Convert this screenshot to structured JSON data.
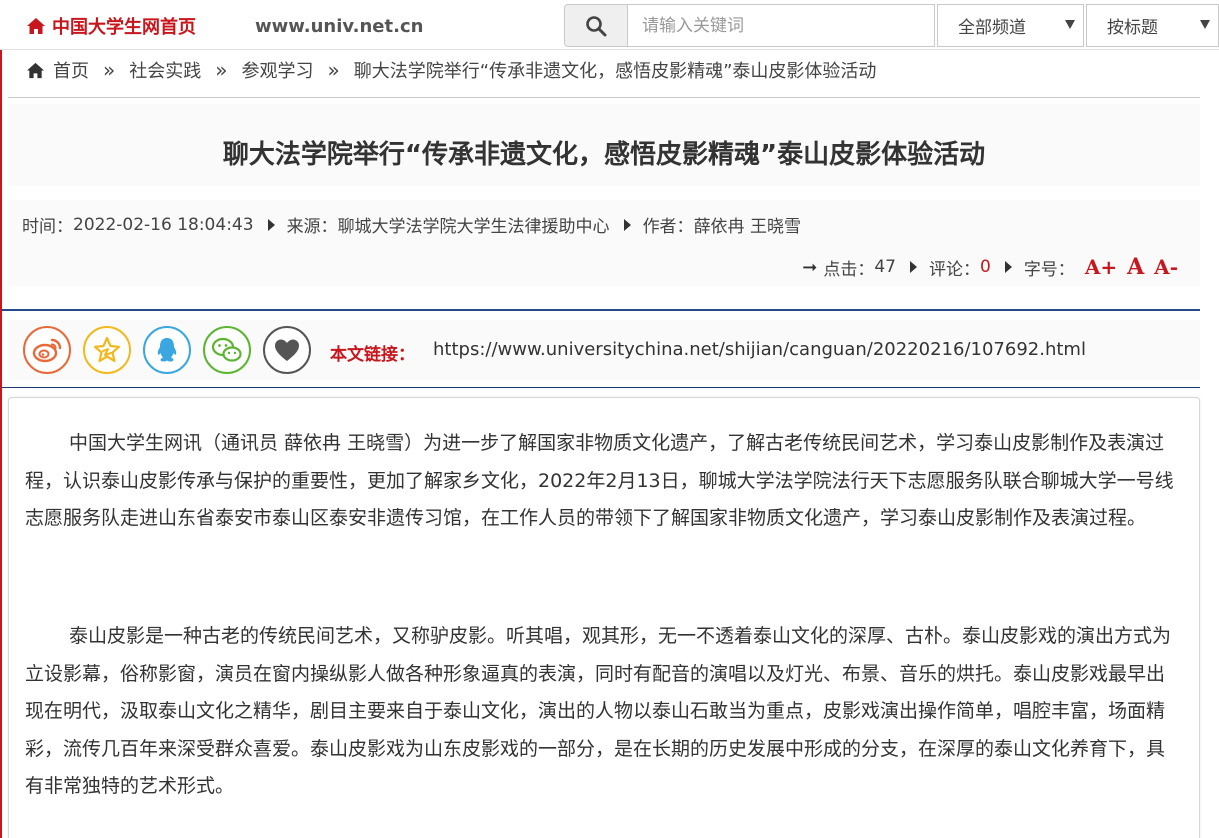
{
  "header": {
    "home_label": "中国大学生网首页",
    "domain": "www.univ.net.cn",
    "search_placeholder": "请输入关键词",
    "channel_select": "全部频道",
    "field_select": "按标题"
  },
  "breadcrumb": {
    "items": [
      "首页",
      "社会实践",
      "参观学习",
      "聊大法学院举行“传承非遗文化，感悟皮影精魂”泰山皮影体验活动"
    ],
    "separator": "»"
  },
  "article": {
    "title": "聊大法学院举行“传承非遗文化，感悟皮影精魂”泰山皮影体验活动",
    "time_label": "时间：",
    "time": "2022-02-16 18:04:43",
    "source_label": "来源：",
    "source": "聊城大学法学院大学生法律援助中心",
    "author_label": "作者：",
    "author": "薛依冉 王晓雪",
    "clicks_label": "点击：",
    "clicks": "47",
    "comments_label": "评论：",
    "comments": "0",
    "fontsize_label": "字号：",
    "font_larger": "A+",
    "font_normal": "A",
    "font_smaller": "A-",
    "paragraphs": [
      "中国大学生网讯（通讯员 薛依冉 王晓雪）为进一步了解国家非物质文化遗产，了解古老传统民间艺术，学习泰山皮影制作及表演过程，认识泰山皮影传承与保护的重要性，更加了解家乡文化，2022年2月13日，聊城大学法学院法行天下志愿服务队联合聊城大学一号线志愿服务队走进山东省泰安市泰山区泰安非遗传习馆，在工作人员的带领下了解国家非物质文化遗产，学习泰山皮影制作及表演过程。",
      "泰山皮影是一种古老的传统民间艺术，又称驴皮影。听其唱，观其形，无一不透着泰山文化的深厚、古朴。泰山皮影戏的演出方式为立设影幕，俗称影窗，演员在窗内操纵影人做各种形象逼真的表演，同时有配音的演唱以及灯光、布景、音乐的烘托。泰山皮影戏最早出现在明代，汲取泰山文化之精华，剧目主要来自于泰山文化，演出的人物以泰山石敢当为重点，皮影戏演出操作简单，唱腔丰富，场面精彩，流传几百年来深受群众喜爱。泰山皮影戏为山东皮影戏的一部分，是在长期的历史发展中形成的分支，在深厚的泰山文化养育下，具有非常独特的艺术形式。"
    ]
  },
  "share": {
    "link_label": "本文链接：",
    "url": "https://www.universitychina.net/shijian/canguan/20220216/107692.html",
    "icons": [
      "weibo-icon",
      "star-icon",
      "qq-icon",
      "wechat-icon",
      "heart-icon"
    ]
  },
  "colors": {
    "brand_red": "#c8161d",
    "navy_rule": "#254a8a",
    "weibo": "#e8693a",
    "star": "#f2b81c",
    "qq": "#3aa7e0",
    "wechat": "#5cb531",
    "heart": "#555555"
  }
}
